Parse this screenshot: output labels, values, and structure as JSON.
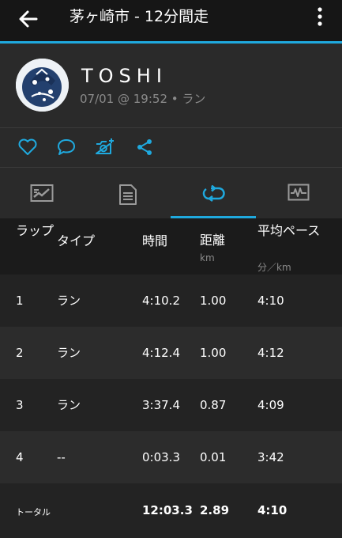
{
  "appbar": {
    "title": "茅ヶ崎市 - 12分間走",
    "back_icon": "arrow-left-icon",
    "more_icon": "more-vertical-icon"
  },
  "profile": {
    "username": "TOSHI",
    "meta": "07/01 @ 19:52 • ラン"
  },
  "actions": [
    {
      "name": "like",
      "icon": "heart-icon"
    },
    {
      "name": "comment",
      "icon": "chat-bubble-icon"
    },
    {
      "name": "add-photo",
      "icon": "camera-plus-icon"
    },
    {
      "name": "share",
      "icon": "share-icon"
    }
  ],
  "tabs": [
    {
      "name": "map",
      "icon": "map-icon",
      "selected": false
    },
    {
      "name": "stats",
      "icon": "document-icon",
      "selected": false
    },
    {
      "name": "laps",
      "icon": "laps-loop-icon",
      "selected": true
    },
    {
      "name": "charts",
      "icon": "chart-icon",
      "selected": false
    }
  ],
  "table": {
    "headers": {
      "lap": "ラップ",
      "type": "タイプ",
      "time": "時間",
      "distance": "距離",
      "distance_unit": "km",
      "pace": "平均ペース",
      "pace_unit": "分／km"
    },
    "rows": [
      {
        "lap": "1",
        "type": "ラン",
        "time": "4:10.2",
        "distance": "1.00",
        "pace": "4:10"
      },
      {
        "lap": "2",
        "type": "ラン",
        "time": "4:12.4",
        "distance": "1.00",
        "pace": "4:12"
      },
      {
        "lap": "3",
        "type": "ラン",
        "time": "3:37.4",
        "distance": "0.87",
        "pace": "4:09"
      },
      {
        "lap": "4",
        "type": "--",
        "time": "0:03.3",
        "distance": "0.01",
        "pace": "3:42"
      }
    ],
    "total": {
      "label": "トータル",
      "time": "12:03.3",
      "distance": "2.89",
      "pace": "4:10"
    }
  },
  "colors": {
    "accent": "#1fa9de",
    "background": "#1b1b1b",
    "panel": "#2a2a2a",
    "muted_text": "#8a8a8a"
  }
}
